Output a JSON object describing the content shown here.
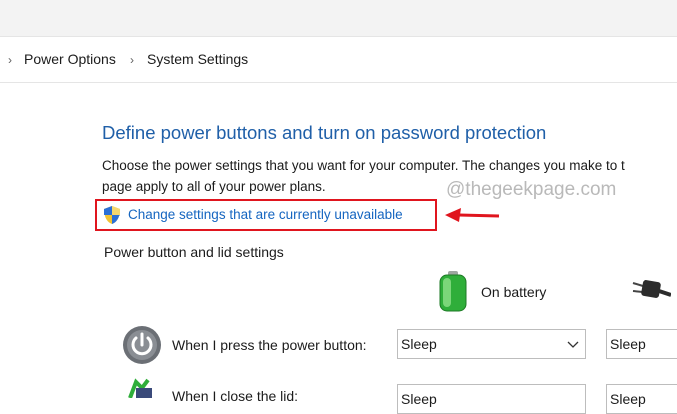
{
  "breadcrumb": {
    "items": [
      "Power Options",
      "System Settings"
    ]
  },
  "main": {
    "heading": "Define power buttons and turn on password protection",
    "description_line1": "Choose the power settings that you want for your computer. The changes you make to t",
    "description_line2": "page apply to all of your power plans.",
    "change_link": "Change settings that are currently unavailable",
    "section_title": "Power button and lid settings",
    "columns": [
      "On battery",
      ""
    ],
    "rows": [
      {
        "label": "When I press the power button:",
        "on_battery": "Sleep",
        "plugged_in": "Sleep"
      },
      {
        "label": "When I close the lid:",
        "on_battery": "Sleep",
        "plugged_in": "Sleep"
      }
    ]
  },
  "watermark": "@thegeekpage.com",
  "colors": {
    "heading": "#1f5fa8",
    "link": "#1565c0",
    "highlight": "#e0151e"
  },
  "icons": {
    "shield": "uac-shield-icon",
    "battery": "battery-icon",
    "plug": "plug-icon",
    "power": "power-button-icon",
    "lid": "laptop-lid-icon"
  }
}
